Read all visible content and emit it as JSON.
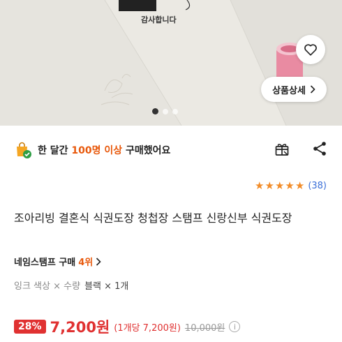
{
  "hero": {
    "image_text": "감사합니다",
    "detail_button_label": "상품상세",
    "slide_count": 3,
    "active_slide": 1
  },
  "purchase": {
    "prefix": "한 달간 ",
    "count_text": "100명 이상",
    "suffix": " 구매했어요"
  },
  "rating": {
    "stars": 5,
    "count_text": "(38)"
  },
  "product": {
    "title": "조아리빙 결혼식 식권도장 청첩장 스탬프 신랑신부 식권도장"
  },
  "rank": {
    "category": "네임스탬프 구매",
    "position": "4위"
  },
  "options": {
    "label": "잉크 색상 × 수량",
    "value": "블랙 × 1개"
  },
  "price": {
    "discount": "28%",
    "sale_price": "7,200원",
    "unit_price": "(1개당 7,200원)",
    "original_price": "10,000원",
    "color_sale": "#e03131"
  },
  "colors": {
    "accent_orange": "#e8590c",
    "star": "#f28c28",
    "rating_count": "#3a6fd8"
  }
}
